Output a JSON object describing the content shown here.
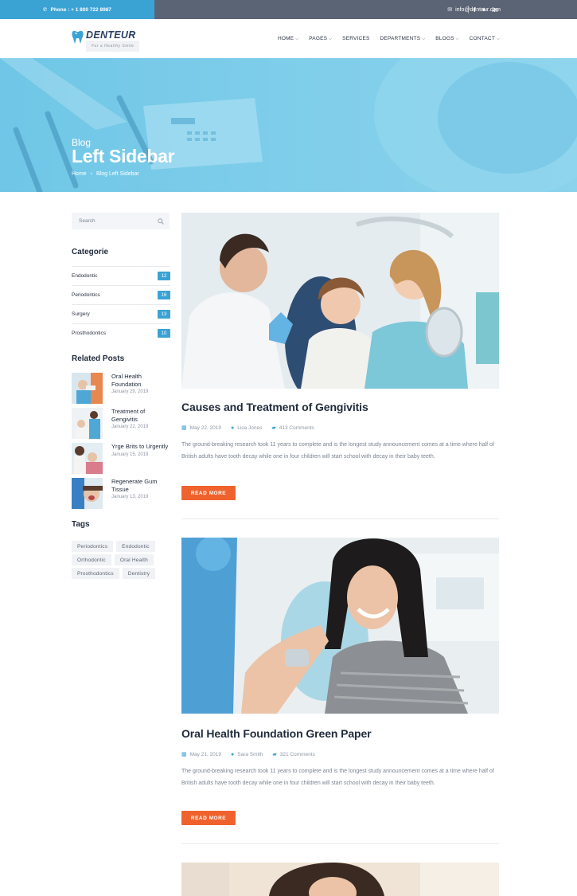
{
  "topbar": {
    "phone": "Phone : + 1 800 722 8987",
    "email": "info@denteur.com",
    "social_icons": [
      "facebook-icon",
      "twitter-icon",
      "linkedin-icon"
    ]
  },
  "brand": {
    "name": "DENTEUR",
    "tagline": "For a Healthy Smile"
  },
  "nav": {
    "items": [
      "HOME",
      "PAGES",
      "SERVICES",
      "DEPARTMENTS",
      "BLOGS",
      "CONTACT"
    ]
  },
  "hero": {
    "subtitle": "Blog",
    "title": "Left Sidebar",
    "breadcrumb": [
      "Home",
      "Blog Left Sidebar"
    ]
  },
  "sidebar": {
    "search_placeholder": "Search",
    "categories_heading": "Categorie",
    "categories": [
      {
        "label": "Endodontic",
        "count": "12"
      },
      {
        "label": "Periodontics",
        "count": "16"
      },
      {
        "label": "Surgery",
        "count": "13"
      },
      {
        "label": "Prosthodontics",
        "count": "10"
      }
    ],
    "related_heading": "Related Posts",
    "related": [
      {
        "title": "Oral Health Foundation",
        "date": "January 29, 2019"
      },
      {
        "title": "Treatment of Gengivitis",
        "date": "January 22, 2019"
      },
      {
        "title": "Yrge Brits to Urgently",
        "date": "January 15, 2019"
      },
      {
        "title": "Regenerate Gum Tissue",
        "date": "January 13, 2019"
      }
    ],
    "tags_heading": "Tags",
    "tags": [
      "Periodontics",
      "Endodontic",
      "Orthodontic",
      "Oral Health",
      "Prosthodontics",
      "Dentistry"
    ]
  },
  "articles": [
    {
      "title": "Causes and Treatment of Gengivitis",
      "date": "May 22, 2019",
      "author": "Lisa Jones",
      "comments": "413 Comments",
      "excerpt": "The ground-breaking research took 11 years to complete and is the longest study announcement comes at a time where half of British adults have tooth decay while one in four children will start school with decay in their baby teeth.",
      "button": "READ MORE"
    },
    {
      "title": "Oral Health Foundation Green Paper",
      "date": "May 21, 2019",
      "author": "Sara Smith",
      "comments": "321 Comments",
      "excerpt": "The ground-breaking research took 11 years to complete and is the longest study announcement comes at a time where half of British adults have tooth decay while one in four children will start school with decay in their baby teeth.",
      "button": "READ MORE"
    }
  ],
  "colors": {
    "accent": "#3ba3d4",
    "button": "#f0622d",
    "topbar": "#5a6474",
    "hero": "#7dcdea"
  }
}
